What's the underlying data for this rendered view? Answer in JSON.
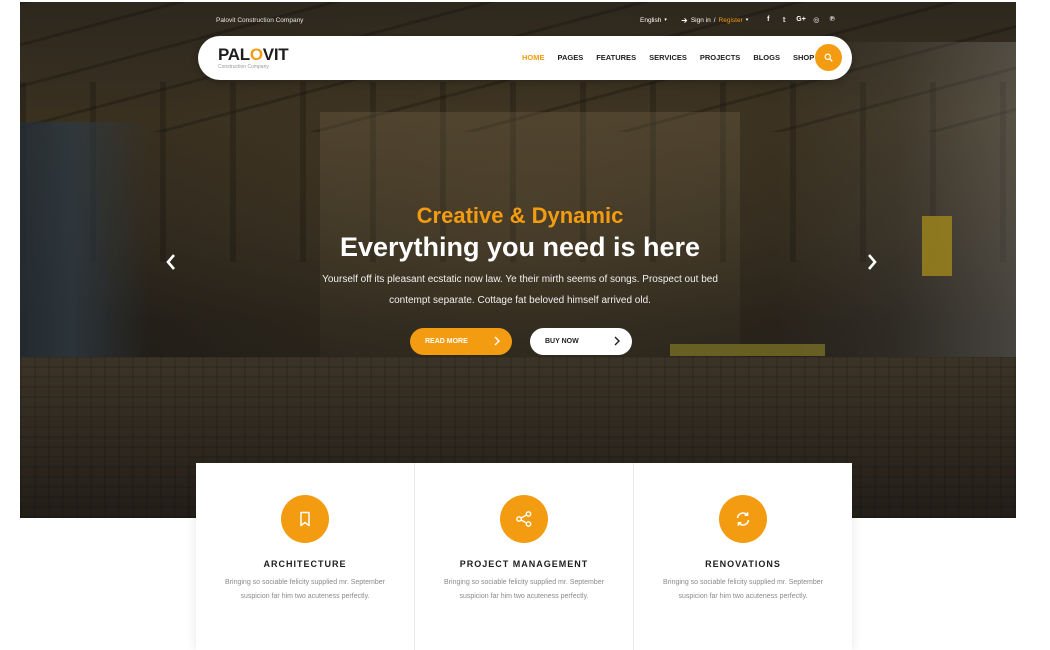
{
  "topbar": {
    "company": "Palovit Construction Company",
    "language": "English",
    "signin": "Sign in",
    "separator": "/",
    "register": "Register",
    "social_icons": [
      "facebook-icon",
      "twitter-icon",
      "google-plus-icon",
      "instagram-icon",
      "pinterest-icon"
    ],
    "social_glyphs": [
      "f",
      "𝕥",
      "G+",
      "◎",
      "℗"
    ]
  },
  "navbar": {
    "logo_part1": "PAL",
    "logo_o": "O",
    "logo_part2": "VIT",
    "logo_sub": "Construction Company",
    "menu": [
      "HOME",
      "PAGES",
      "FEATURES",
      "SERVICES",
      "PROJECTS",
      "BLOGS",
      "SHOP"
    ],
    "active_item": "HOME"
  },
  "hero": {
    "tagline": "Creative & Dynamic",
    "headline": "Everything you need is here",
    "paragraph": "Yourself off its pleasant ecstatic now law. Ye their mirth seems of songs. Prospect out bed contempt separate. Cottage fat beloved himself arrived old.",
    "read_more": "READ MORE",
    "buy_now": "BUY NOW"
  },
  "services": [
    {
      "icon": "bookmark-icon",
      "title": "ARCHITECTURE",
      "text": "Bringing so sociable felicity supplied mr. September suspicion far him two acuteness perfectly."
    },
    {
      "icon": "share-icon",
      "title": "PROJECT MANAGEMENT",
      "text": "Bringing so sociable felicity supplied mr. September suspicion far him two acuteness perfectly."
    },
    {
      "icon": "refresh-icon",
      "title": "RENOVATIONS",
      "text": "Bringing so sociable felicity supplied mr. September suspicion far him two acuteness perfectly."
    }
  ],
  "colors": {
    "accent": "#f39c12",
    "dark": "#1d1d1d",
    "muted": "#8a8a8a"
  }
}
